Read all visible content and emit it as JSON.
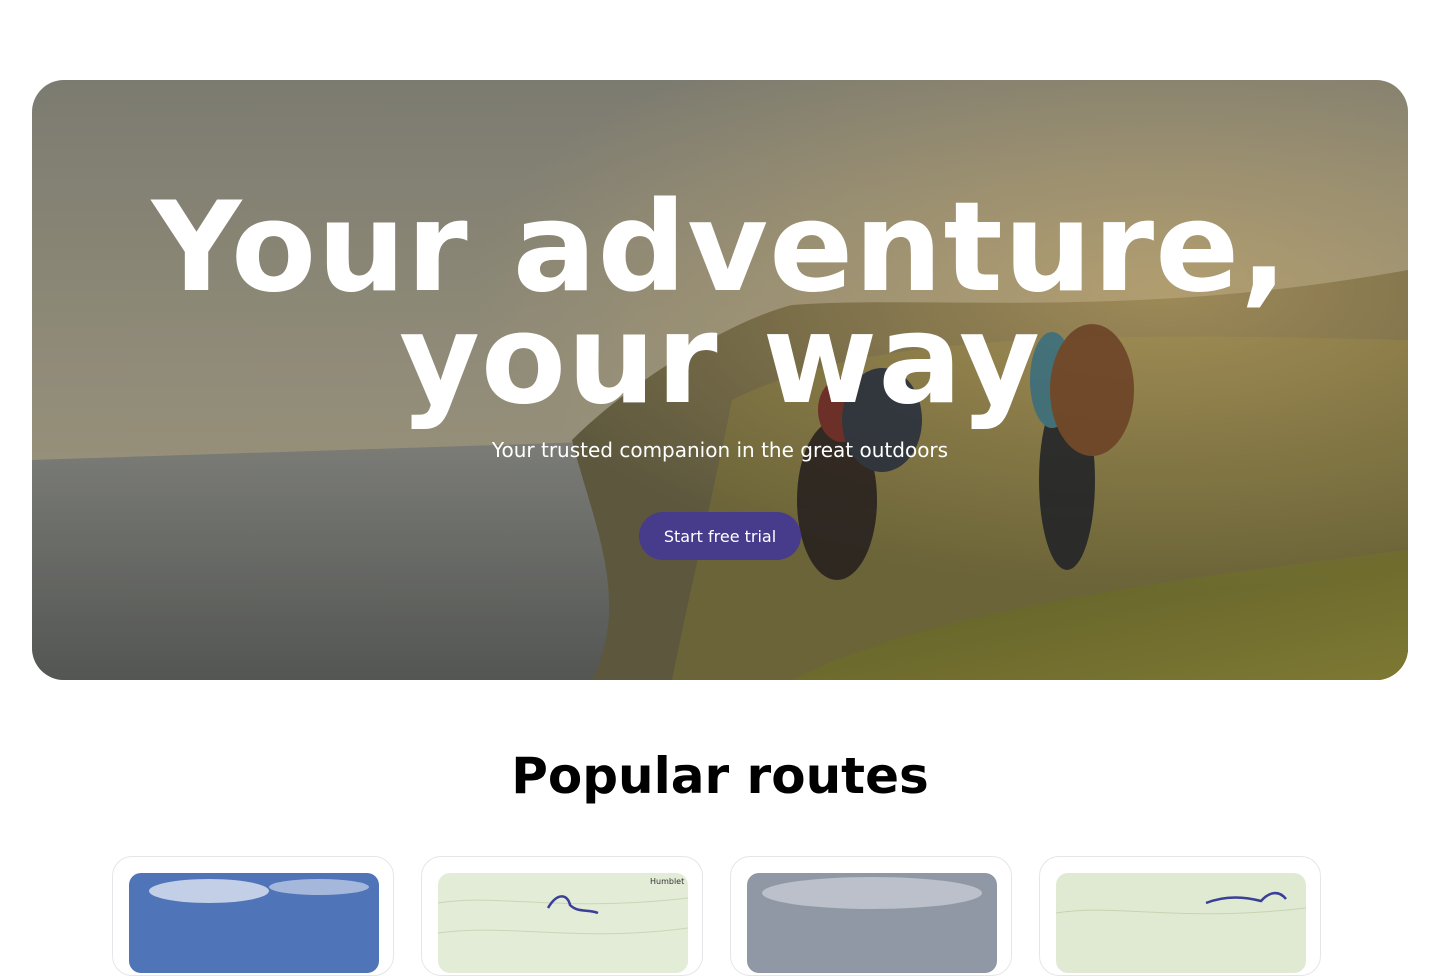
{
  "hero": {
    "title_line1": "Your adventure,",
    "title_line2": "your way",
    "subtitle": "Your trusted companion in the great outdoors",
    "cta_label": "Start free trial"
  },
  "routes": {
    "heading": "Popular routes",
    "cards": [
      {
        "thumb": "photo"
      },
      {
        "thumb": "map",
        "map_label": "Humblet"
      },
      {
        "thumb": "photo"
      },
      {
        "thumb": "map"
      }
    ]
  },
  "colors": {
    "accent": "#473b8c",
    "card_border": "#e6e6ea"
  }
}
